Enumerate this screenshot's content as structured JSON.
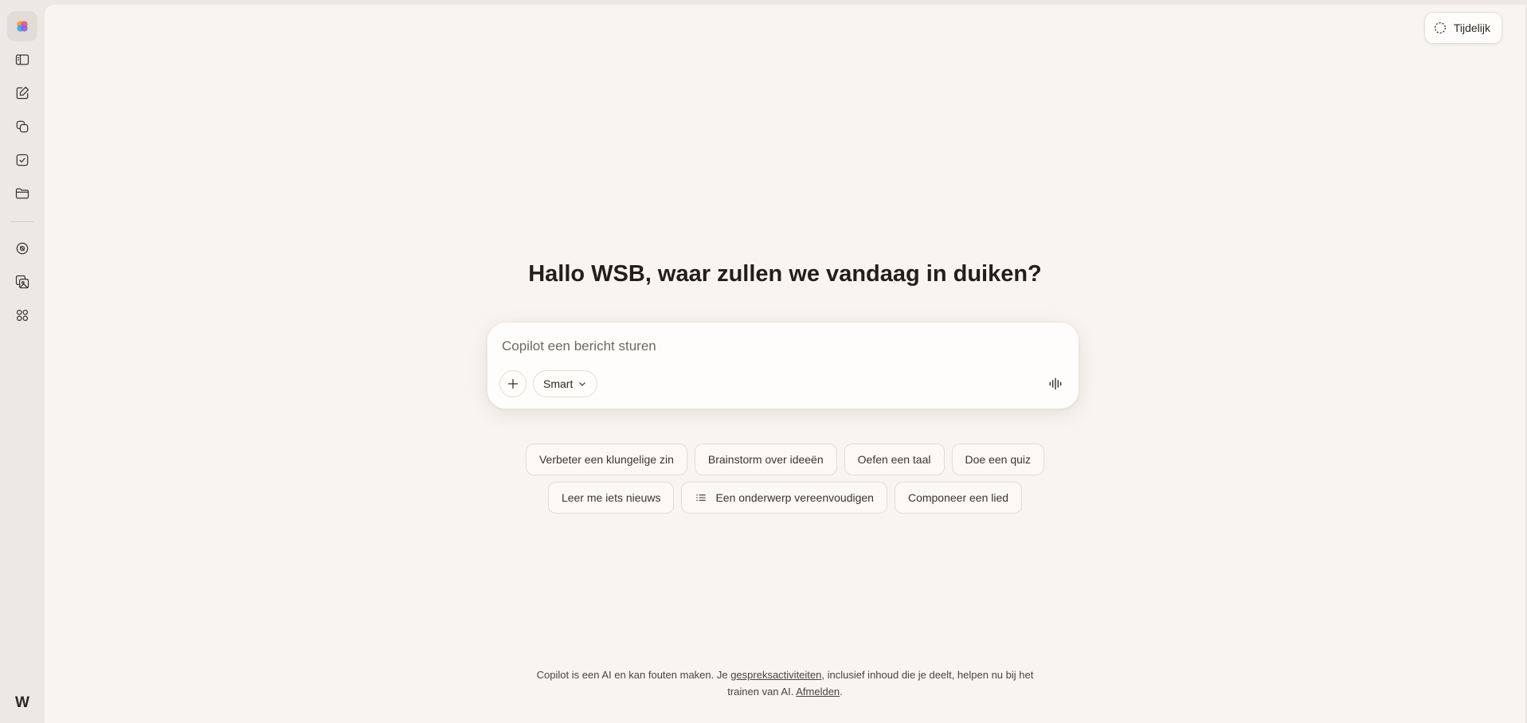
{
  "sidebar": {
    "items": [
      {
        "name": "copilot-logo-icon"
      },
      {
        "name": "sidebar-toggle-icon"
      },
      {
        "name": "new-chat-icon"
      },
      {
        "name": "pages-icon"
      },
      {
        "name": "tasks-icon"
      },
      {
        "name": "folder-icon"
      },
      {
        "name": "discover-icon"
      },
      {
        "name": "image-gallery-icon"
      },
      {
        "name": "apps-grid-icon"
      }
    ],
    "avatar_initial": "W"
  },
  "header": {
    "temporary_label": "Tijdelijk"
  },
  "main": {
    "greeting": "Hallo WSB, waar zullen we vandaag in duiken?",
    "composer": {
      "placeholder": "Copilot een bericht sturen",
      "mode_label": "Smart"
    },
    "suggestions_row1": [
      "Verbeter een klungelige zin",
      "Brainstorm over ideeën",
      "Oefen een taal",
      "Doe een quiz"
    ],
    "suggestions_row2": [
      "Leer me iets nieuws",
      "Een onderwerp vereenvoudigen",
      "Componeer een lied"
    ]
  },
  "footer": {
    "text_part1": "Copilot is een AI en kan fouten maken. Je ",
    "link1": "gespreksactiviteiten",
    "text_part2": ", inclusief inhoud die je deelt, helpen nu bij het",
    "text_part3": "trainen van AI. ",
    "link2": "Afmelden",
    "text_part4": "."
  },
  "colors": {
    "sidebar_bg": "#ede8e3",
    "main_bg": "#f8f4f1",
    "text": "#2b2622"
  }
}
